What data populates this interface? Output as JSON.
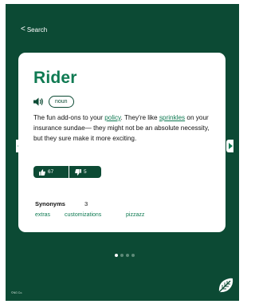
{
  "nav": {
    "back_label": "Search"
  },
  "entry": {
    "word": "Rider",
    "part_of_speech": "noun",
    "definition": {
      "p1": "The fun add-ons to your ",
      "link1": "policy",
      "p2": ". They're like ",
      "link2": "sprinkles",
      "p3": " on your insurance sundae— they might not be an absolute necessity, but they sure make it more exciting."
    },
    "votes": {
      "up": "67",
      "down": "5"
    },
    "synonyms": {
      "title": "Synonyms",
      "count": "3",
      "items": [
        "extras",
        "customizations",
        "pizzazz"
      ]
    }
  },
  "pagination": {
    "total": 4,
    "current": 1
  },
  "footer": {
    "copyright": "©NG Co."
  },
  "colors": {
    "brand_dark": "#0c4a34",
    "brand_green": "#0f7a52",
    "card": "#ffffff"
  }
}
